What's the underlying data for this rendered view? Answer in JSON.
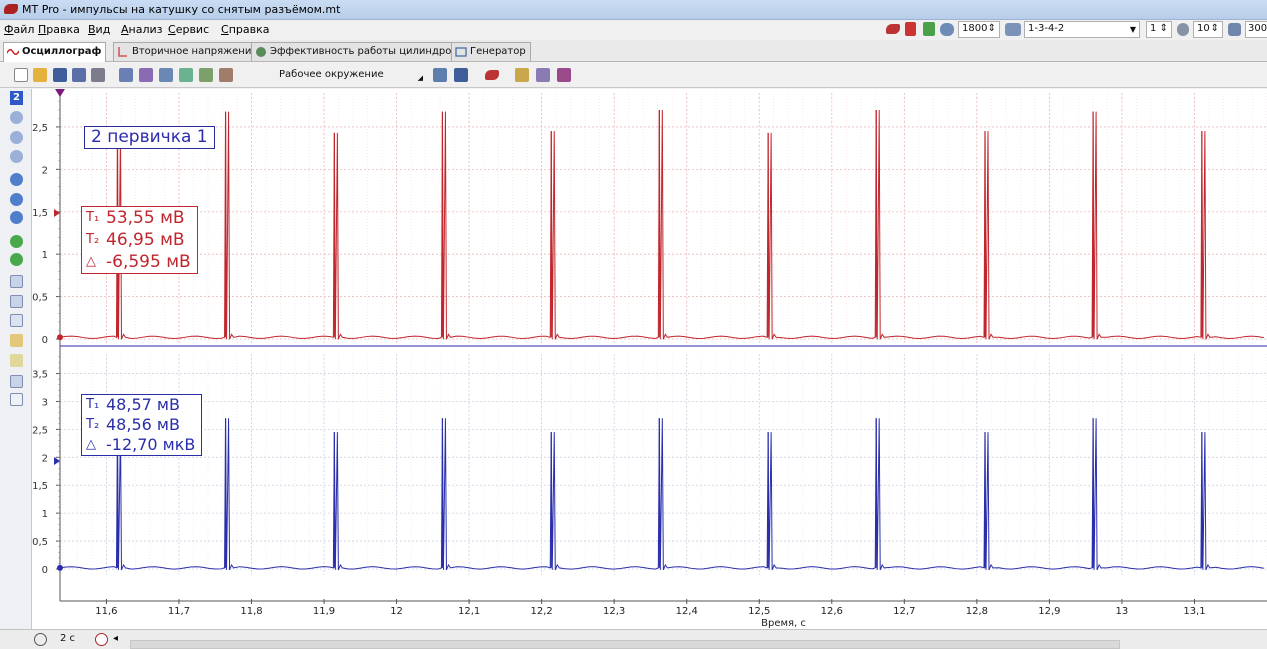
{
  "window": {
    "title": "MT Pro - импульсы на катушку со снятым разъёмом.mt"
  },
  "menu": [
    "Файл",
    "Правка",
    "Вид",
    "Анализ",
    "Сервис",
    "Справка"
  ],
  "tabs": [
    {
      "label": "Осциллограф",
      "active": true
    },
    {
      "label": "Вторичное напряжение",
      "active": false
    },
    {
      "label": "Эффективность работы цилиндров",
      "active": false
    },
    {
      "label": "Генератор",
      "active": false
    }
  ],
  "toolbar": {
    "workspace_label": "Рабочее окружение"
  },
  "topright": {
    "rpm_value": "1800",
    "firing_order": "1-3-4-2",
    "cylinder_value": "1",
    "count_value": "10",
    "extra_value": "300"
  },
  "leftbar": {
    "channel_number": "2"
  },
  "plot": {
    "channel_title": "2 первичка 1",
    "red_measurements": {
      "t1": "53,55 мВ",
      "t2": "46,95 мВ",
      "delta": "-6,595 мВ"
    },
    "blue_measurements": {
      "t1": "48,57 мВ",
      "t2": "48,56 мВ",
      "delta": "-12,70 мкВ"
    },
    "x_axis_title": "Время, с"
  },
  "status": {
    "time_value": "2 с"
  },
  "chart_data": [
    {
      "type": "line",
      "name": "red-channel",
      "color": "#c0262d",
      "ylim": [
        0,
        2.9
      ],
      "y_ticks": [
        "0",
        "0,5",
        "1",
        "1,5",
        "2",
        "2,5"
      ],
      "x_ticks": [
        "11,6",
        "11,7",
        "11,8",
        "11,9",
        "12",
        "12,1",
        "12,2",
        "12,3",
        "12,4",
        "12,5",
        "12,6",
        "12,7",
        "12,8",
        "12,9",
        "13",
        "13,1"
      ],
      "xlim": [
        11.536,
        13.2
      ],
      "baseline": 0.02,
      "pulses": [
        {
          "x": 11.618,
          "peak": 2.5
        },
        {
          "x": 11.767,
          "peak": 2.68
        },
        {
          "x": 11.917,
          "peak": 2.43
        },
        {
          "x": 12.066,
          "peak": 2.68
        },
        {
          "x": 12.216,
          "peak": 2.45
        },
        {
          "x": 12.365,
          "peak": 2.7
        },
        {
          "x": 12.515,
          "peak": 2.43
        },
        {
          "x": 12.664,
          "peak": 2.7
        },
        {
          "x": 12.814,
          "peak": 2.45
        },
        {
          "x": 12.963,
          "peak": 2.68
        },
        {
          "x": 13.113,
          "peak": 2.45
        }
      ]
    },
    {
      "type": "line",
      "name": "blue-channel",
      "color": "#2a2eaa",
      "ylim": [
        0,
        3.85
      ],
      "y_ticks": [
        "0",
        "0,5",
        "1",
        "1,5",
        "2",
        "2,5",
        "3",
        "3,5"
      ],
      "x_ticks": [
        "11,6",
        "11,7",
        "11,8",
        "11,9",
        "12",
        "12,1",
        "12,2",
        "12,3",
        "12,4",
        "12,5",
        "12,6",
        "12,7",
        "12,8",
        "12,9",
        "13",
        "13,1"
      ],
      "xlim": [
        11.536,
        13.2
      ],
      "baseline": 0.02,
      "pulses": [
        {
          "x": 11.618,
          "peak": 2.55
        },
        {
          "x": 11.767,
          "peak": 2.7
        },
        {
          "x": 11.917,
          "peak": 2.45
        },
        {
          "x": 12.066,
          "peak": 2.7
        },
        {
          "x": 12.216,
          "peak": 2.45
        },
        {
          "x": 12.365,
          "peak": 2.7
        },
        {
          "x": 12.515,
          "peak": 2.45
        },
        {
          "x": 12.664,
          "peak": 2.7
        },
        {
          "x": 12.814,
          "peak": 2.45
        },
        {
          "x": 12.963,
          "peak": 2.7
        },
        {
          "x": 13.113,
          "peak": 2.45
        }
      ]
    }
  ]
}
